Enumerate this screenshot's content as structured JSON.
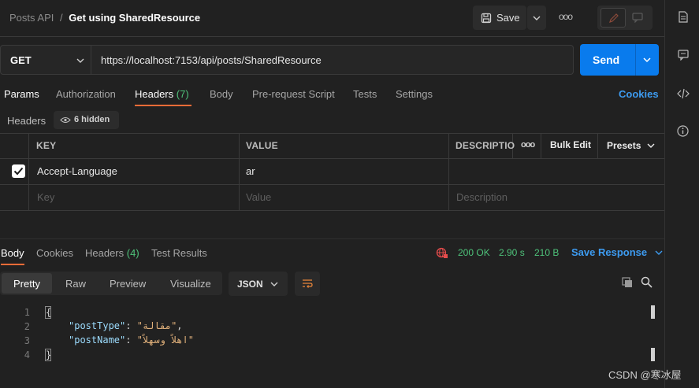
{
  "breadcrumb": {
    "collection": "Posts API",
    "separator": "/",
    "request": "Get using SharedResource"
  },
  "toolbar": {
    "save_label": "Save",
    "more_label": "ooo"
  },
  "request": {
    "method": "GET",
    "url": "https://localhost:7153/api/posts/SharedResource",
    "send_label": "Send"
  },
  "tabs": {
    "params": "Params",
    "authorization": "Authorization",
    "headers": "Headers",
    "headers_count": "(7)",
    "body": "Body",
    "pre_request": "Pre-request Script",
    "tests": "Tests",
    "settings": "Settings",
    "cookies": "Cookies"
  },
  "headers_bar": {
    "label": "Headers",
    "hidden": "6 hidden"
  },
  "table": {
    "col_key": "KEY",
    "col_value": "VALUE",
    "col_desc": "DESCRIPTIO",
    "more": "ooo",
    "bulk_edit": "Bulk Edit",
    "presets": "Presets",
    "rows": [
      {
        "key": "Accept-Language",
        "value": "ar",
        "checked": true
      }
    ],
    "placeholder": {
      "key": "Key",
      "value": "Value",
      "description": "Description"
    }
  },
  "response": {
    "tabs": {
      "body": "Body",
      "cookies": "Cookies",
      "headers": "Headers",
      "headers_count": "(4)",
      "test_results": "Test Results"
    },
    "status": "200 OK",
    "time": "2.90 s",
    "size": "210 B",
    "save_response": "Save Response",
    "view": {
      "pretty": "Pretty",
      "raw": "Raw",
      "preview": "Preview",
      "visualize": "Visualize",
      "format": "JSON"
    },
    "lines": [
      "1",
      "2",
      "3",
      "4"
    ],
    "code": {
      "open": "{",
      "line2_key": "\"postType\"",
      "line2_sep": ": ",
      "line2_val": "\"مقالة\"",
      "line2_end": ",",
      "line3_key": "\"postName\"",
      "line3_sep": ": ",
      "line3_val": "\"اهلاً وسهلاً\"",
      "close": "}"
    }
  },
  "watermark": "CSDN @寒冰屋",
  "colors": {
    "accent": "#097bed",
    "status_ok": "#4ec27a",
    "tab_underline": "#ff6c37",
    "key_blue": "#9cdcfe"
  }
}
